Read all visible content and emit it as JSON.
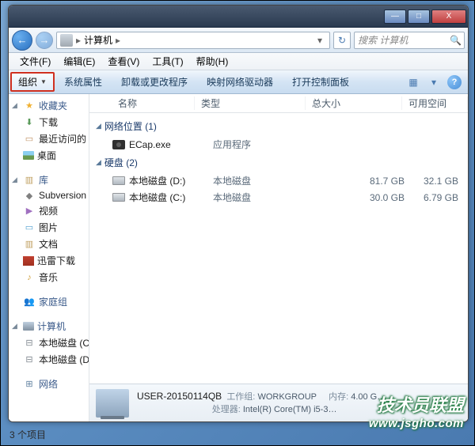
{
  "titlebar": {
    "path_hint": ""
  },
  "window_controls": {
    "min": "—",
    "max": "□",
    "close": "X"
  },
  "nav": {
    "back": "←",
    "forward": "→",
    "breadcrumb": {
      "root_icon": true,
      "sep": "▸",
      "current": "计算机",
      "sep2": "▸"
    },
    "refresh": "↻",
    "search_placeholder": "搜索 计算机",
    "search_icon": "🔍"
  },
  "menubar": {
    "file": "文件(F)",
    "edit": "编辑(E)",
    "view": "查看(V)",
    "tools": "工具(T)",
    "help": "帮助(H)"
  },
  "toolbar": {
    "organize": "组织",
    "organize_arrow": "▼",
    "properties": "系统属性",
    "uninstall": "卸载或更改程序",
    "map_drive": "映射网络驱动器",
    "control_panel": "打开控制面板",
    "view_icon": "▦",
    "view_dd": "▾",
    "help": "?"
  },
  "columns": {
    "name": "名称",
    "type": "类型",
    "total": "总大小",
    "free": "可用空间"
  },
  "groups": {
    "network": {
      "tri": "◢",
      "label": "网络位置 (1)"
    },
    "disks": {
      "tri": "◢",
      "label": "硬盘 (2)"
    }
  },
  "items": {
    "ecap": {
      "name": "ECap.exe",
      "type": "应用程序"
    },
    "drive_d": {
      "name": "本地磁盘 (D:)",
      "type": "本地磁盘",
      "total": "81.7 GB",
      "free": "32.1 GB"
    },
    "drive_c": {
      "name": "本地磁盘 (C:)",
      "type": "本地磁盘",
      "total": "30.0 GB",
      "free": "6.79 GB"
    }
  },
  "sidebar": {
    "fav": {
      "label": "收藏夹",
      "items": {
        "downloads": "下载",
        "recent": "最近访问的",
        "desktop": "桌面"
      }
    },
    "lib": {
      "label": "库",
      "items": {
        "svn": "Subversion",
        "video": "视频",
        "pictures": "图片",
        "docs": "文档",
        "xunlei": "迅雷下载",
        "music": "音乐"
      }
    },
    "homegroup": {
      "label": "家庭组"
    },
    "computer": {
      "label": "计算机",
      "items": {
        "drive_c": "本地磁盘 (C",
        "drive_d": "本地磁盘 (D"
      }
    },
    "network": {
      "label": "网络"
    }
  },
  "details": {
    "name": "USER-20150114QB",
    "workgroup_lbl": "工作组:",
    "workgroup": "WORKGROUP",
    "memory_lbl": "内存:",
    "memory": "4.00 G…",
    "cpu_lbl": "处理器:",
    "cpu": "Intel(R) Core(TM) i5-3…"
  },
  "status": {
    "items": "3 个项目"
  },
  "watermark": {
    "title": "技术员联盟",
    "url": "www.jsgho.com"
  }
}
